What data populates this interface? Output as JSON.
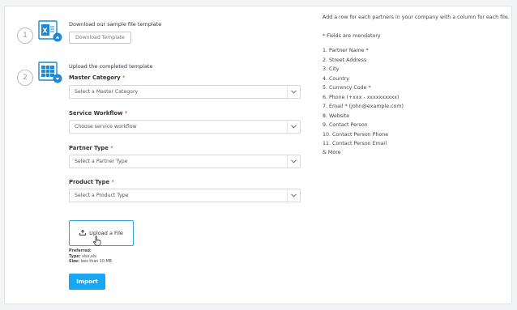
{
  "step1": {
    "number": "1",
    "title": "Download our sample file template",
    "button_label": "Download Template"
  },
  "step2": {
    "number": "2",
    "title": "Upload the completed template"
  },
  "fields": {
    "master_category": {
      "label": "Master Category",
      "required_mark": "*",
      "placeholder": "Select a Master Category"
    },
    "service_workflow": {
      "label": "Service Workflow",
      "required_mark": "*",
      "placeholder": "Choose service workflow"
    },
    "partner_type": {
      "label": "Partner Type",
      "required_mark": "*",
      "placeholder": "Select a Partner Type"
    },
    "product_type": {
      "label": "Product Type",
      "required_mark": "*",
      "placeholder": "Select a Product Type"
    }
  },
  "upload": {
    "button_label": "Upload a File",
    "preferred_label": "Preferred:",
    "type_label": "Type:",
    "type_value": "xlsx,xls",
    "size_label": "Size:",
    "size_value": "less than 10 MB"
  },
  "import_button_label": "Import",
  "instructions": {
    "intro": "Add a row for each partners in your company with a column for each file.",
    "mandatory_note": "* Fields are mendatory",
    "items": [
      "1. Partner Name *",
      "2. Street Address",
      "3. City",
      "4. Country",
      "5. Currency Code *",
      "6. Phone (+xxx - xxxxxxxxxx)",
      "7. Email * (john@example.com)",
      "8. Website",
      "9. Contact Person",
      "10. Contact Person Phone",
      "11. Contact Person Email",
      "& More"
    ]
  },
  "colors": {
    "accent": "#18a6f0",
    "icon_blue": "#1e88d6",
    "required": "#e3342f"
  },
  "icons": [
    "excel-file-icon",
    "table-upload-icon",
    "chevron-down-icon",
    "upload-icon",
    "hand-pointer-icon"
  ]
}
